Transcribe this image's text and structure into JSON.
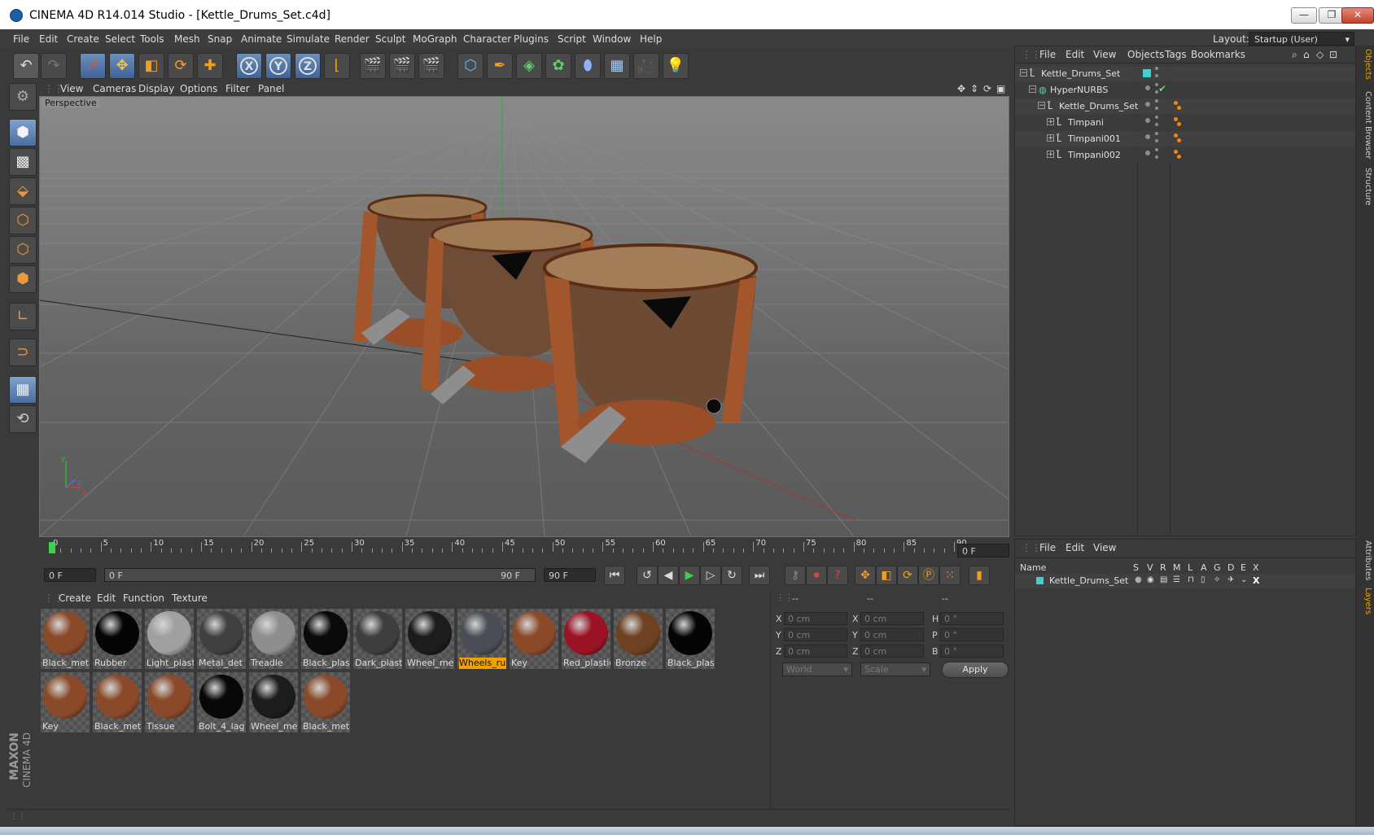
{
  "window": {
    "title": "CINEMA 4D R14.014 Studio - [Kettle_Drums_Set.c4d]",
    "minimize": "—",
    "restore": "❐",
    "close": "✕"
  },
  "menubar": {
    "items": [
      "File",
      "Edit",
      "Create",
      "Select",
      "Tools",
      "Mesh",
      "Snap",
      "Animate",
      "Simulate",
      "Render",
      "Sculpt",
      "MoGraph",
      "Character",
      "Plugins",
      "Script",
      "Window",
      "Help"
    ],
    "layout_label": "Layout:",
    "layout_value": "Startup (User)"
  },
  "viewport": {
    "menu": [
      "View",
      "Cameras",
      "Display",
      "Options",
      "Filter",
      "Panel"
    ],
    "label": "Perspective",
    "axis_x": "x",
    "axis_y": "y",
    "axis_z": "z"
  },
  "timeline": {
    "ticks": [
      "0",
      "5",
      "10",
      "15",
      "20",
      "25",
      "30",
      "35",
      "40",
      "45",
      "50",
      "55",
      "60",
      "65",
      "70",
      "75",
      "80",
      "85",
      "90"
    ],
    "current_frame": "0 F"
  },
  "anim": {
    "start": "0 F",
    "range_start": "0 F",
    "range_end": "90 F",
    "end": "90 F"
  },
  "materials_panel": {
    "menu": [
      "Create",
      "Edit",
      "Function",
      "Texture"
    ],
    "items": [
      {
        "name": "Black_meta",
        "color": "#8a4a2a"
      },
      {
        "name": "Rubber",
        "color": "#050505"
      },
      {
        "name": "Light_plast",
        "color": "#a0a0a0"
      },
      {
        "name": "Metal_det",
        "color": "#404040"
      },
      {
        "name": "Treadle",
        "color": "#8e8e8e"
      },
      {
        "name": "Black_plast",
        "color": "#0a0a0a"
      },
      {
        "name": "Dark_plasti",
        "color": "#3e3e3e"
      },
      {
        "name": "Wheel_met",
        "color": "#1c1c1c"
      },
      {
        "name": "Wheels_rul",
        "color": "#4a4d55",
        "selected": true
      },
      {
        "name": "Key",
        "color": "#8a4a2a"
      },
      {
        "name": "Red_plastic",
        "color": "#9a1325"
      },
      {
        "name": "Bronze",
        "color": "#6e4122"
      },
      {
        "name": "Black_plast",
        "color": "#050505"
      },
      {
        "name": "Key",
        "color": "#8a4a2a"
      },
      {
        "name": "Black_meta",
        "color": "#8a4a2a"
      },
      {
        "name": "Tissue",
        "color": "#8a4a2a"
      },
      {
        "name": "Bolt_4_lag",
        "color": "#080808"
      },
      {
        "name": "Wheel_met",
        "color": "#1c1c1c"
      },
      {
        "name": "Black_meta",
        "color": "#8a4a2a"
      }
    ]
  },
  "coords": {
    "headers": [
      "--",
      "--",
      "--"
    ],
    "rows": [
      {
        "a": "X",
        "av": "0 cm",
        "b": "X",
        "bv": "0 cm",
        "c": "H",
        "cv": "0 °"
      },
      {
        "a": "Y",
        "av": "0 cm",
        "b": "Y",
        "bv": "0 cm",
        "c": "P",
        "cv": "0 °"
      },
      {
        "a": "Z",
        "av": "0 cm",
        "b": "Z",
        "bv": "0 cm",
        "c": "B",
        "cv": "0 °"
      }
    ],
    "world": "World",
    "scale": "Scale",
    "apply": "Apply"
  },
  "objects_panel": {
    "menu": [
      "File",
      "Edit",
      "View",
      "Objects",
      "Tags",
      "Bookmarks"
    ],
    "rows": [
      {
        "name": "Kettle_Drums_Set",
        "indent": 0,
        "exp": "−",
        "color": "#3fd0d0"
      },
      {
        "name": "HyperNURBS",
        "indent": 1,
        "exp": "−",
        "check": "✔"
      },
      {
        "name": "Kettle_Drums_Set",
        "indent": 2,
        "exp": "−",
        "tag": true
      },
      {
        "name": "Timpani",
        "indent": 3,
        "exp": "+",
        "tag": true
      },
      {
        "name": "Timpani001",
        "indent": 3,
        "exp": "+",
        "tag": true
      },
      {
        "name": "Timpani002",
        "indent": 3,
        "exp": "+",
        "tag": true
      }
    ]
  },
  "layers_panel": {
    "menu": [
      "File",
      "Edit",
      "View"
    ],
    "columns": [
      "Name",
      "S",
      "V",
      "R",
      "M",
      "L",
      "A",
      "G",
      "D",
      "E",
      "X"
    ],
    "rows": [
      {
        "name": "Kettle_Drums_Set",
        "color": "#3fd0d0"
      }
    ]
  },
  "right_tabs": [
    "Objects",
    "Content Browser",
    "Structure",
    "Attributes",
    "Layers"
  ],
  "brand": {
    "maxon": "MAXON",
    "product": "CINEMA 4D"
  }
}
